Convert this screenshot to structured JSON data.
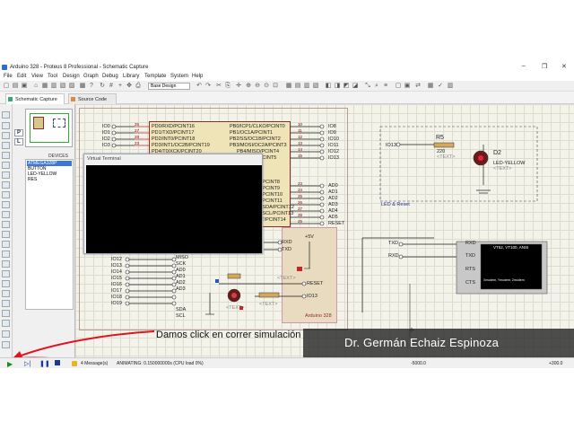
{
  "window": {
    "title": "Arduino 328 - Proteus 8 Professional - Schematic Capture",
    "controls": [
      "–",
      "❐",
      "✕"
    ]
  },
  "menu": [
    "File",
    "Edit",
    "View",
    "Tool",
    "Design",
    "Graph",
    "Debug",
    "Library",
    "Template",
    "System",
    "Help"
  ],
  "toolbar": {
    "design_select": "Base Design"
  },
  "tabs": [
    {
      "label": "Schematic Capture",
      "active": true
    },
    {
      "label": "Source Code",
      "active": false
    }
  ],
  "sidebar": {
    "mode_letters": [
      "P",
      "L"
    ],
    "devices_label": "DEVICES",
    "devices": [
      "ATMEGA328P",
      "BUTTON",
      "LED-YELLOW",
      "RES"
    ]
  },
  "schematic": {
    "chip_left_pins": [
      "26",
      "27",
      "28",
      "23",
      "24",
      "25"
    ],
    "chip_left_ports": [
      "PD0/RXD/PCINT16",
      "PD1/TXD/PCINT17",
      "PD2/INT0/PCINT18",
      "PD3/INT1/OC2B/PCINT19",
      "PD4/T0/XCK/PCINT20"
    ],
    "chip_right_ports": [
      "PB0/ICP1/CLKO/PCINT0",
      "PB1/OC1A/PCINT1",
      "PB2/SS/OC1B/PCINT2",
      "PB3/MOSI/OC2A/PCINT3",
      "PB4/MISO/PCINT4",
      "PB5/SCK/PCINT5",
      "PC0/ADC0/PCINT8",
      "PC1/ADC1/PCINT9",
      "PC2/ADC2/PCINT10",
      "PC3/ADC3/PCINT11",
      "PC4/ADC4/SDA/PCINT12",
      "PC5/ADC5/SCL/PCINT13",
      "PC6/RESET/PCINT14"
    ],
    "right_pin_numbers": [
      "10",
      "11",
      "12",
      "13",
      "14",
      "15",
      "16",
      "17",
      "23",
      "24",
      "25",
      "26",
      "27",
      "28",
      "29",
      "30",
      "26"
    ],
    "io_left_top": [
      "IO0",
      "IO1",
      "IO2",
      "IO3"
    ],
    "io_right_top": [
      "IO8",
      "IO9",
      "IO10",
      "IO11",
      "IO12",
      "IO13"
    ],
    "analog_labels": [
      "AD0",
      "AD1",
      "AD2",
      "AD3",
      "AD4",
      "AD5",
      "RESET"
    ],
    "io_left_bottom": [
      "IO12",
      "IO13",
      "IO14",
      "IO15",
      "IO16",
      "IO17",
      "IO18",
      "IO19"
    ],
    "io_bottom_nets": [
      "MISO",
      "SCK",
      "AD0",
      "AD1",
      "AD2",
      "AD3",
      "SDA",
      "SCL"
    ],
    "rxtx": [
      "RXD",
      "TXD"
    ],
    "vcc": "+5V",
    "text_placeholder": "<TEXT>",
    "reset_label": "RESET",
    "io13_label": "IO13",
    "chip_name": "Arduino 328",
    "led_group": {
      "io": "IO13",
      "resistor": "R5",
      "res_value": "220",
      "led": "D2",
      "led_type": "LED-YELLOW",
      "label": "LED & Reset"
    },
    "terminal2": {
      "pins": [
        "RXD",
        "TXD",
        "RTS",
        "CTS"
      ],
      "screen_title": "VT52, VT100, ANSI",
      "screen_sub": "Xmodem, Ymodem, Zmodem",
      "nets": [
        "TXD",
        "RXD"
      ]
    }
  },
  "virtual_terminal": {
    "title": "Virtual Terminal"
  },
  "status": {
    "messages": "4 Message(s)",
    "animating": "ANIMATING: 0.150000000s (CPU load 0%)",
    "coord_x": "-5000.0",
    "coord_y": "+300.0"
  },
  "annotation": {
    "text": "Damos click en correr simulación"
  },
  "banner": {
    "text": "Dr. Germán Echaiz Espinoza"
  },
  "colors": {
    "wire": "#1a1a1a",
    "chip_fill": "#efe3b8",
    "chip_border": "#8b2d2d",
    "net_label": "#1a2a9a",
    "red_arrow": "#e0141e",
    "banner_bg": "#2a2a2a",
    "selection": "#3b77d8"
  }
}
